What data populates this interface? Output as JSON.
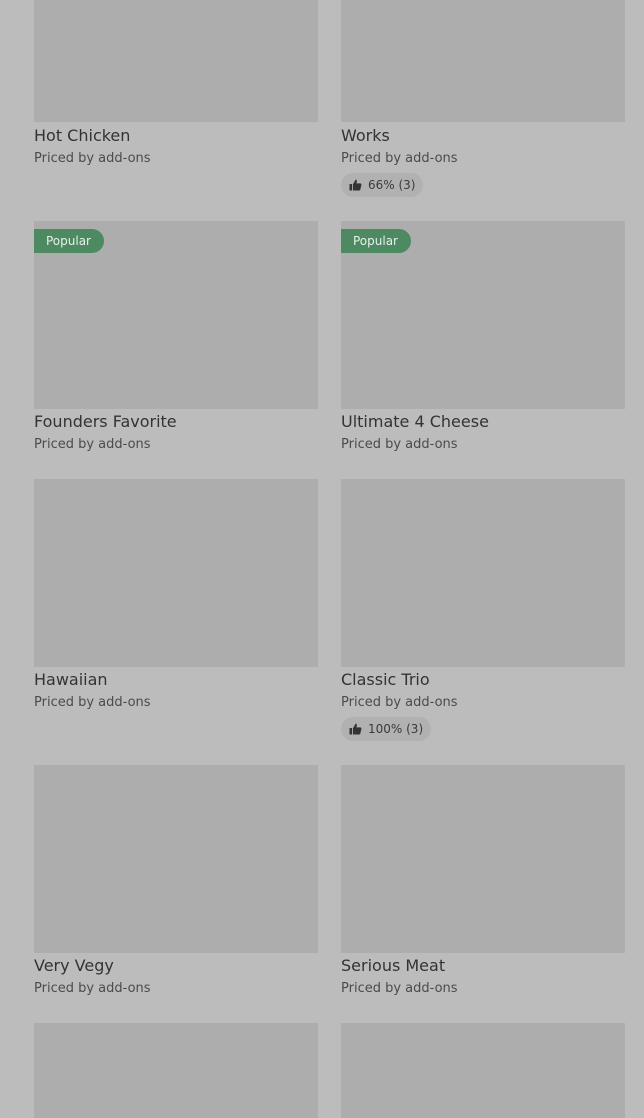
{
  "items": [
    {
      "name": "Hot Chicken",
      "price_label": "Priced by add-ons"
    },
    {
      "name": "Works",
      "price_label": "Priced by add-ons",
      "rating": {
        "icon": "thumbs-up-icon",
        "text": "66% (3)"
      }
    },
    {
      "name": "Founders Favorite",
      "price_label": "Priced by add-ons",
      "badge": "Popular"
    },
    {
      "name": "Ultimate 4 Cheese",
      "price_label": "Priced by add-ons",
      "badge": "Popular"
    },
    {
      "name": "Hawaiian",
      "price_label": "Priced by add-ons"
    },
    {
      "name": "Classic Trio",
      "price_label": "Priced by add-ons",
      "rating": {
        "icon": "thumbs-up-icon",
        "text": "100% (3)"
      }
    },
    {
      "name": "Very Vegy",
      "price_label": "Priced by add-ons"
    },
    {
      "name": "Serious Meat",
      "price_label": "Priced by add-ons"
    }
  ],
  "colors": {
    "background": "#bcbcbc",
    "image_placeholder": "#adadad",
    "badge": "#4d8a61",
    "rating_pill": "#b1b1b1"
  }
}
